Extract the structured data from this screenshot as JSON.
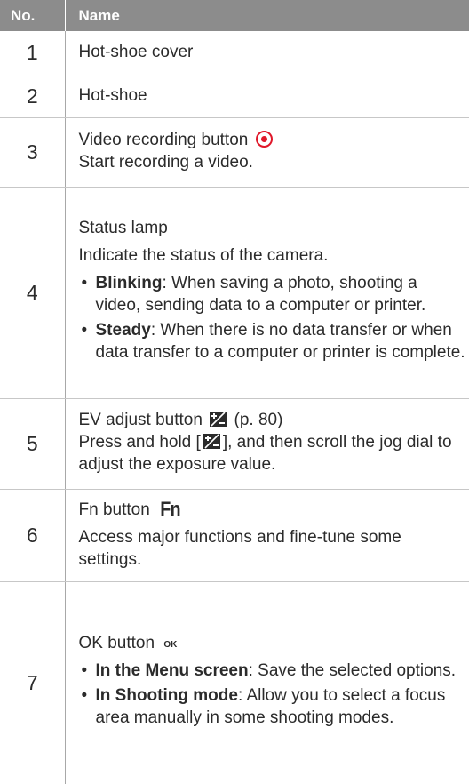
{
  "table": {
    "headers": {
      "no": "No.",
      "name": "Name"
    },
    "rows": [
      {
        "no": "1",
        "title": "Hot-shoe cover"
      },
      {
        "no": "2",
        "title": "Hot-shoe"
      },
      {
        "no": "3",
        "title": "Video recording button",
        "icon": "record-icon",
        "desc": "Start recording a video."
      },
      {
        "no": "4",
        "title": "Status lamp",
        "desc": "Indicate the status of the camera.",
        "bullets": [
          {
            "term": "Blinking",
            "text": ": When saving a photo, shooting a video, sending data to a computer or printer."
          },
          {
            "term": "Steady",
            "text": ": When there is no data transfer or when data transfer to a computer or printer is complete."
          }
        ]
      },
      {
        "no": "5",
        "title": "EV adjust button",
        "icon": "ev-icon",
        "page_ref": "(p. 80)",
        "desc_pre": "Press and hold [",
        "desc_post": "], and then scroll the jog dial to adjust the exposure value."
      },
      {
        "no": "6",
        "title": "Fn button",
        "icon_text": "Fn",
        "desc": "Access major functions and fine-tune some settings."
      },
      {
        "no": "7",
        "title": "OK button",
        "icon_text": "OK",
        "icon": "ok-icon",
        "bullets": [
          {
            "term": "In the Menu screen",
            "text": ": Save the selected options."
          },
          {
            "term": "In Shooting mode",
            "text": ": Allow you to select a focus area manually in some shooting modes."
          }
        ]
      }
    ]
  },
  "colors": {
    "header_bg": "#8c8c8c",
    "record_red": "#e0182a",
    "text": "#2b2b2b"
  }
}
